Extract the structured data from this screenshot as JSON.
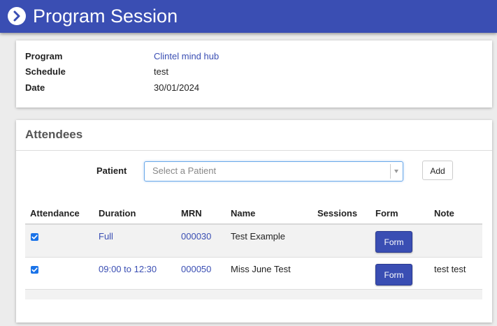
{
  "header": {
    "title": "Program Session",
    "back_icon": "chevron-right-circle-icon",
    "background": "#3a4eb3"
  },
  "info": {
    "rows": [
      {
        "label": "Program",
        "value": "Clintel mind hub"
      },
      {
        "label": "Schedule",
        "value": "test"
      },
      {
        "label": "Date",
        "value": "30/01/2024"
      }
    ]
  },
  "attendees": {
    "title": "Attendees",
    "patient_label": "Patient",
    "patient_select_placeholder": "Select a Patient",
    "add_label": "Add",
    "columns": [
      "Attendance",
      "Duration",
      "MRN",
      "Name",
      "Sessions",
      "Form",
      "Note"
    ],
    "rows": [
      {
        "attendance": true,
        "duration": "Full",
        "mrn": "000030",
        "name": "Test Example",
        "sessions": "",
        "form": "Form",
        "note": ""
      },
      {
        "attendance": true,
        "duration": "09:00 to 12:30",
        "mrn": "000050",
        "name": "Miss June Test",
        "sessions": "",
        "form": "Form",
        "note": "test test"
      }
    ]
  },
  "colors": {
    "accent": "#3a4eb3",
    "link": "#3a4eb3",
    "checkbox": "#1a73e8",
    "focus_border": "#6aa9e9"
  }
}
